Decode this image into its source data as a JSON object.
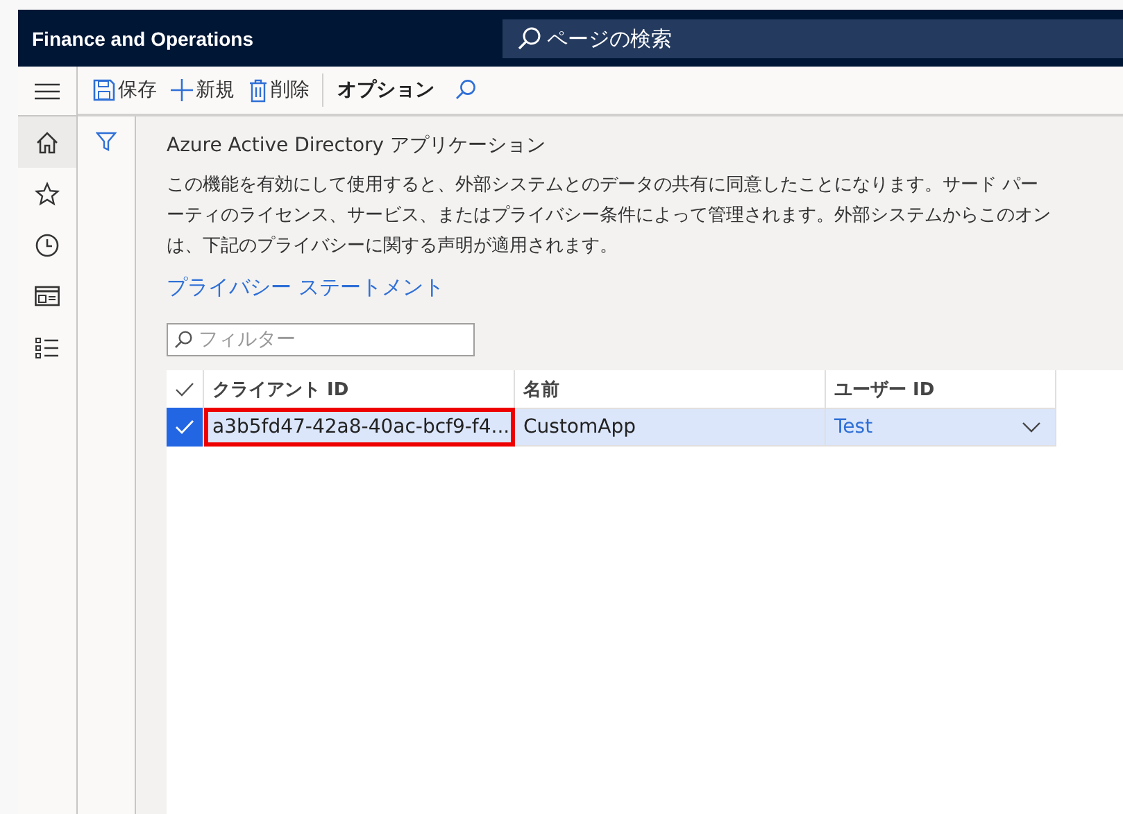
{
  "header": {
    "app_title": "Finance and Operations",
    "search": {
      "placeholder": "ページの検索"
    }
  },
  "toolbar": {
    "buttons": [
      {
        "kind": "save",
        "label": "保存"
      },
      {
        "kind": "new",
        "label": "新規"
      },
      {
        "kind": "delete",
        "label": "削除"
      }
    ],
    "tabs": [
      {
        "label": "オプション",
        "selected": true
      }
    ]
  },
  "nav": [
    {
      "kind": "home",
      "selected": true
    },
    {
      "kind": "star",
      "selected": false
    },
    {
      "kind": "clock",
      "selected": false
    },
    {
      "kind": "workspace",
      "selected": false
    },
    {
      "kind": "list",
      "selected": false
    }
  ],
  "page": {
    "title": "Azure Active Directory アプリケーション",
    "description_lines": [
      "この機能を有効にして使用すると、外部システムとのデータの共有に同意したことになります。サード パー",
      "ーティのライセンス、サービス、またはプライバシー条件によって管理されます。外部システムからこのオン",
      "は、下記のプライバシーに関する声明が適用されます。"
    ],
    "link": "プライバシー ステートメント",
    "filter": {
      "placeholder": "フィルター"
    },
    "table": {
      "columns": [
        "クライアント ID",
        "名前",
        "ユーザー ID"
      ],
      "rows": [
        {
          "selected": true,
          "client_id": "a3b5fd47-42a8-40ac-bcf9-f4...",
          "client_id_highlighted": true,
          "name": "CustomApp",
          "user_id": "Test"
        }
      ]
    }
  }
}
